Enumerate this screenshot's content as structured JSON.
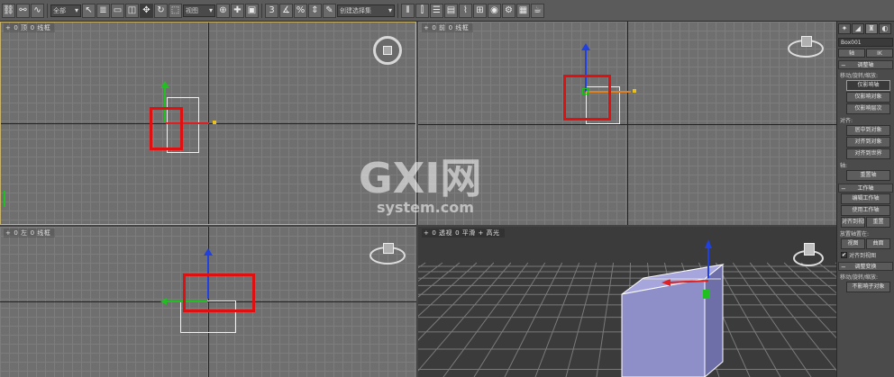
{
  "toolbar": {
    "selection_filter": "全部",
    "ref_coord": "视图",
    "named_selection": "创建选择集"
  },
  "viewports": {
    "top": {
      "num": "+",
      "name": "0 顶",
      "mode": "0 线框"
    },
    "front": {
      "num": "+",
      "name": "0 前",
      "mode": "0 线框"
    },
    "left": {
      "num": "+",
      "name": "0 左",
      "mode": "0 线框"
    },
    "perspective": {
      "num": "+",
      "name": "0 透视",
      "mode": "0 平滑 + 高光"
    }
  },
  "watermark": {
    "brand": "GXI网",
    "domain": "system.com"
  },
  "panel": {
    "object_name": "Box001",
    "sub_tabs": [
      "轴",
      "IK"
    ],
    "rollout_adjust_pivot": "调整轴",
    "group_move_rotate_scale": "移动/旋转/缩放:",
    "btn_affect_pivot_only": "仅影响轴",
    "btn_affect_object_only": "仅影响对象",
    "btn_affect_hierarchy_only": "仅影响层次",
    "group_alignment": "对齐:",
    "btn_center_to_object": "居中到对象",
    "btn_align_to_object": "对齐到对象",
    "btn_align_to_world": "对齐到世界",
    "group_pivot": "轴:",
    "btn_reset_pivot": "重置轴",
    "rollout_working_pivot": "工作轴",
    "btn_edit_working_pivot": "编辑工作轴",
    "btn_use_working_pivot": "使用工作轴",
    "btn_align_to_view": "对齐到视图",
    "btn_reset": "重置",
    "group_place_pivot": "放置轴置在:",
    "btn_view": "视图",
    "btn_surface": "曲面",
    "chk_align_to_view": "对齐到视图",
    "rollout_adjust_transform": "调整变换",
    "group_move_rotate_scale_2": "移动/旋转/缩放:",
    "btn_dont_affect_children": "不影响子对象"
  },
  "colors": {
    "highlight_rect": "#e01010",
    "axis_x": "#e02020",
    "axis_y": "#20c020",
    "axis_z": "#2040e0",
    "box_fill": "#8e8ec8",
    "active_viewport_border": "#c9b36a"
  }
}
